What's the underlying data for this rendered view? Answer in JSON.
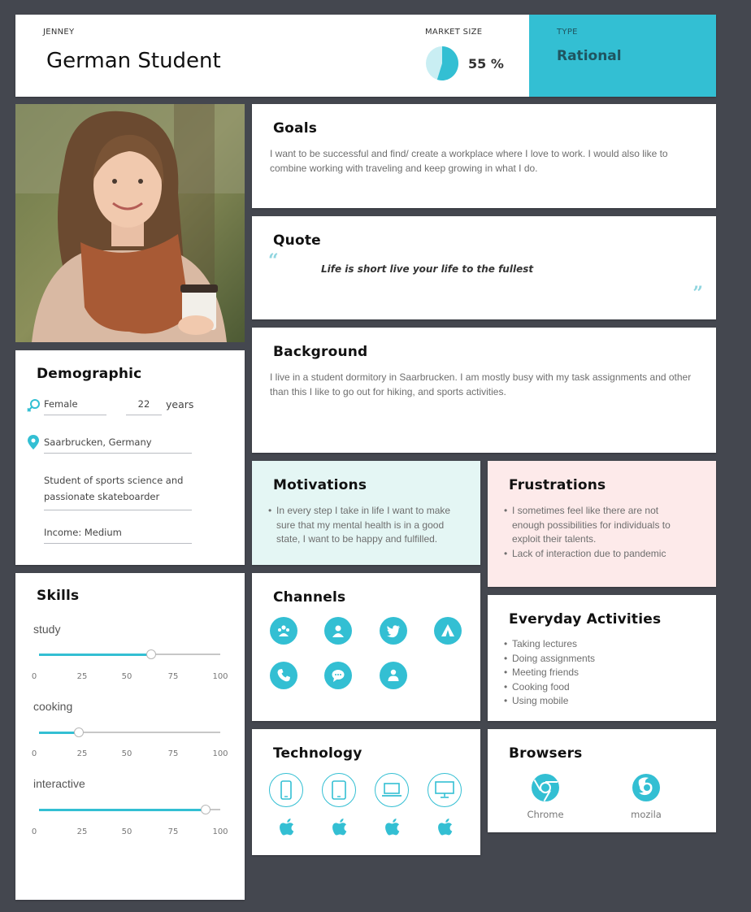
{
  "header": {
    "persona_name": "JENNEY",
    "title": "German Student",
    "market_label": "MARKET SIZE",
    "market_value": "55 %",
    "market_fraction": 0.55,
    "type_label": "TYPE",
    "type_value": "Rational"
  },
  "colors": {
    "accent": "#33bfd3",
    "background": "#44474f",
    "motivations_bg": "#e4f6f4",
    "frustrations_bg": "#fdeaea"
  },
  "goals": {
    "title": "Goals",
    "text": "I want to be successful and find/ create a workplace where I love to work. I would also like to combine working with traveling and keep growing in what I do."
  },
  "quote": {
    "title": "Quote",
    "text": "Life is short live your life to the fullest",
    "open_mark": "“",
    "close_mark": "”"
  },
  "background": {
    "title": "Background",
    "text": "I live in a student dormitory in Saarbrucken. I am mostly busy with my task assignments and other than this I like to go out for hiking, and sports activities."
  },
  "demographic": {
    "title": "Demographic",
    "gender": "Female",
    "age": "22",
    "age_unit": "years",
    "location": "Saarbrucken, Germany",
    "occupation": "Student of sports science and passionate skateboarder",
    "income": "Income: Medium"
  },
  "skills": {
    "title": "Skills",
    "scale": [
      "0",
      "25",
      "50",
      "75",
      "100"
    ],
    "items": [
      {
        "label": "study",
        "value": 62
      },
      {
        "label": "cooking",
        "value": 22
      },
      {
        "label": "interactive",
        "value": 92
      }
    ]
  },
  "motivations": {
    "title": "Motivations",
    "items": [
      "In every step I take in life I want to make sure that my mental health is in a good state, I want to be happy and fulfilled."
    ]
  },
  "frustrations": {
    "title": "Frustrations",
    "items": [
      "I sometimes feel like there are not enough possibilities for individuals to exploit their talents.",
      "Lack of interaction due to pandemic"
    ]
  },
  "channels": {
    "title": "Channels",
    "icons": [
      "community-icon",
      "user-icon",
      "twitter-icon",
      "tent-icon",
      "phone-icon",
      "chat-icon",
      "person-icon"
    ]
  },
  "everyday": {
    "title": "Everyday Activities",
    "items": [
      "Taking lectures",
      "Doing assignments",
      "Meeting friends",
      "Cooking food",
      "Using mobile"
    ]
  },
  "technology": {
    "title": "Technology",
    "devices": [
      "phone-icon",
      "tablet-icon",
      "laptop-icon",
      "desktop-icon"
    ],
    "platforms": [
      "apple-icon",
      "apple-icon",
      "apple-icon",
      "apple-icon"
    ]
  },
  "browsers": {
    "title": "Browsers",
    "items": [
      {
        "name": "Chrome",
        "icon": "chrome-icon"
      },
      {
        "name": "mozila",
        "icon": "firefox-icon"
      }
    ]
  }
}
